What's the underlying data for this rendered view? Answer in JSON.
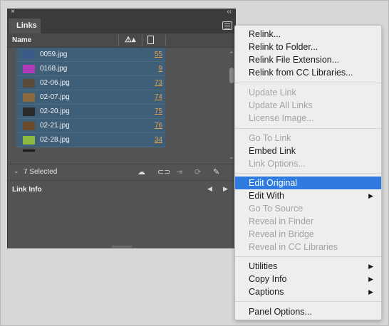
{
  "panel": {
    "close_glyph": "×",
    "collapse_glyph": "‹‹",
    "tab_label": "Links",
    "column_name": "Name",
    "rows": [
      {
        "file": "0059.jpg",
        "page": "55",
        "thumb_color": "#3a5a8a"
      },
      {
        "file": "0168.jpg",
        "page": "9",
        "thumb_color": "#b03ab8"
      },
      {
        "file": "02-06.jpg",
        "page": "73",
        "thumb_color": "#5a4a3a"
      },
      {
        "file": "02-07.jpg",
        "page": "74",
        "thumb_color": "#8a6a3a"
      },
      {
        "file": "02-20.jpg",
        "page": "75",
        "thumb_color": "#2a2a2a"
      },
      {
        "file": "02-21.jpg",
        "page": "76",
        "thumb_color": "#6a4a2a"
      },
      {
        "file": "02-28.jpg",
        "page": "34",
        "thumb_color": "#8ab840"
      }
    ],
    "selected_count": "7 Selected",
    "link_info_title": "Link Info"
  },
  "context_menu": {
    "items": [
      {
        "label": "Relink...",
        "state": "enabled"
      },
      {
        "label": "Relink to Folder...",
        "state": "enabled"
      },
      {
        "label": "Relink File Extension...",
        "state": "enabled"
      },
      {
        "label": "Relink from CC Libraries...",
        "state": "enabled"
      },
      {
        "label": "Update Link",
        "state": "disabled"
      },
      {
        "label": "Update All Links",
        "state": "disabled"
      },
      {
        "label": "License Image...",
        "state": "disabled"
      },
      {
        "label": "Go To Link",
        "state": "disabled"
      },
      {
        "label": "Embed Link",
        "state": "enabled"
      },
      {
        "label": "Link Options...",
        "state": "disabled"
      },
      {
        "label": "Edit Original",
        "state": "highlighted"
      },
      {
        "label": "Edit With",
        "state": "enabled",
        "submenu": true
      },
      {
        "label": "Go To Source",
        "state": "disabled"
      },
      {
        "label": "Reveal in Finder",
        "state": "disabled"
      },
      {
        "label": "Reveal in Bridge",
        "state": "disabled"
      },
      {
        "label": "Reveal in CC Libraries",
        "state": "disabled"
      },
      {
        "label": "Utilities",
        "state": "enabled",
        "submenu": true
      },
      {
        "label": "Copy Info",
        "state": "enabled",
        "submenu": true
      },
      {
        "label": "Captions",
        "state": "enabled",
        "submenu": true
      },
      {
        "label": "Panel Options...",
        "state": "enabled"
      }
    ],
    "submenu_glyph": "▶"
  },
  "colors": {
    "panel_bg": "#535353",
    "selection": "#3f5e78",
    "page_link": "#e8a050",
    "menu_highlight": "#2f7be0"
  }
}
